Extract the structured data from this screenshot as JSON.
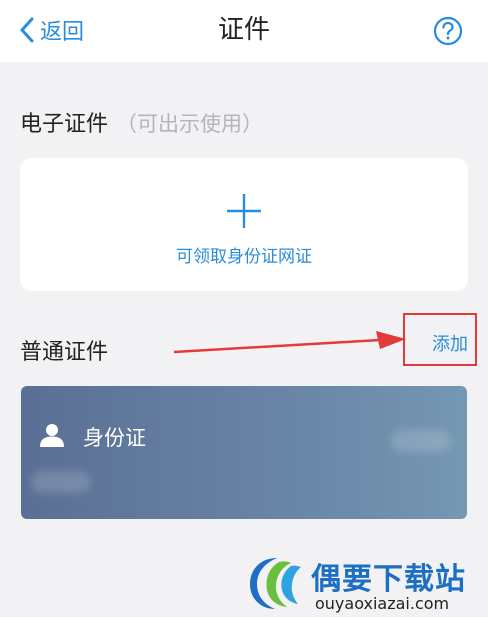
{
  "nav": {
    "back_label": "返回",
    "title": "证件"
  },
  "electronic": {
    "title": "电子证件",
    "subtitle": "（可出示使用）",
    "card_label": "可领取身份证网证"
  },
  "regular": {
    "title": "普通证件",
    "add_label": "添加",
    "card_label": "身份证"
  },
  "watermark": {
    "title": "偶要下载站",
    "url": "ouyaoxiazai.com"
  },
  "colors": {
    "accent": "#2a8ddc",
    "annotation": "#e33a3a",
    "card_gradient_start": "#5a6f95",
    "card_gradient_end": "#7598b3"
  },
  "icons": {
    "back": "chevron-left-icon",
    "help": "question-circle-icon",
    "add": "plus-icon",
    "person": "person-icon"
  }
}
